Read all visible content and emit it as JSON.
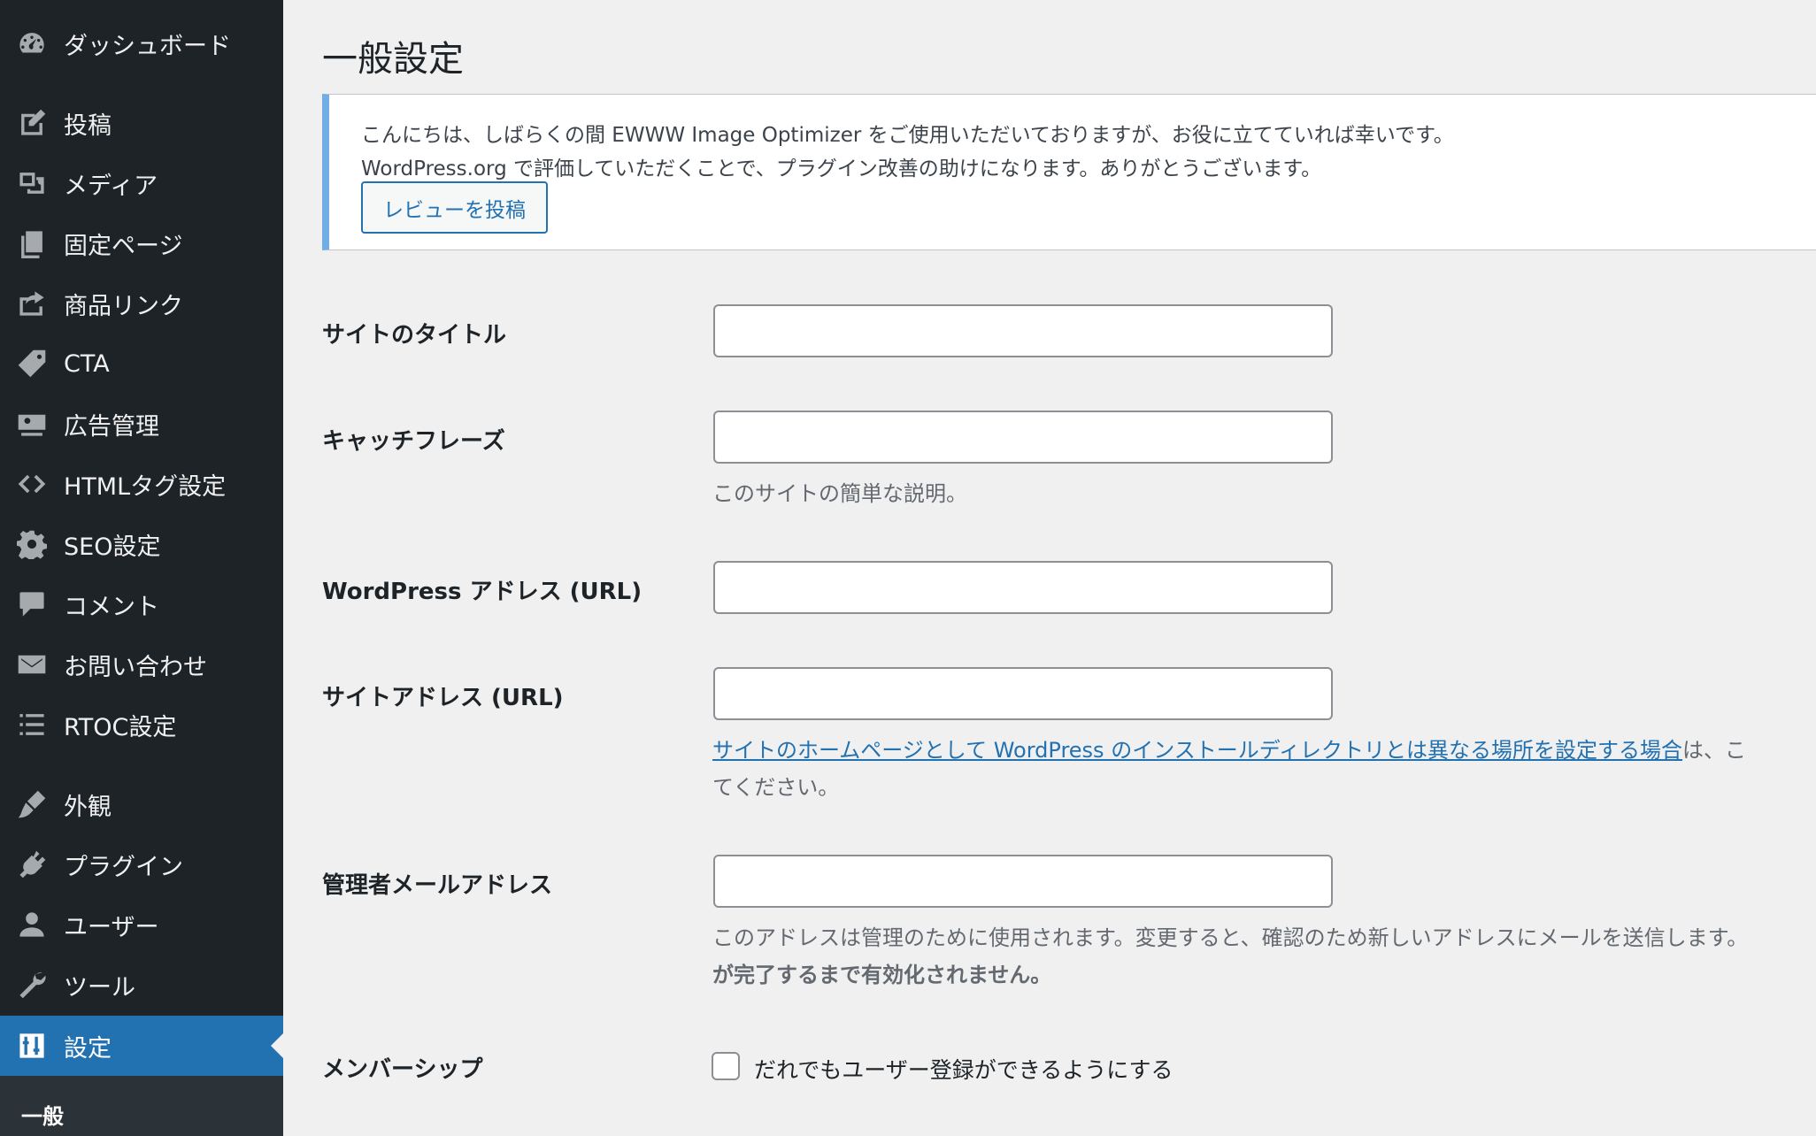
{
  "sidebar": {
    "items": [
      {
        "label": "ダッシュボード",
        "icon": "dashboard-icon"
      },
      {
        "label": "投稿",
        "icon": "post-edit-icon"
      },
      {
        "label": "メディア",
        "icon": "media-icon"
      },
      {
        "label": "固定ページ",
        "icon": "pages-icon"
      },
      {
        "label": "商品リンク",
        "icon": "external-link-icon"
      },
      {
        "label": "CTA",
        "icon": "tag-icon"
      },
      {
        "label": "広告管理",
        "icon": "ad-icon"
      },
      {
        "label": "HTMLタグ設定",
        "icon": "code-icon"
      },
      {
        "label": "SEO設定",
        "icon": "gear-icon"
      },
      {
        "label": "コメント",
        "icon": "comment-icon"
      },
      {
        "label": "お問い合わせ",
        "icon": "mail-icon"
      },
      {
        "label": "RTOC設定",
        "icon": "list-icon"
      },
      {
        "label": "外観",
        "icon": "brush-icon"
      },
      {
        "label": "プラグイン",
        "icon": "plugin-icon"
      },
      {
        "label": "ユーザー",
        "icon": "user-icon"
      },
      {
        "label": "ツール",
        "icon": "wrench-icon"
      },
      {
        "label": "設定",
        "icon": "settings-sliders-icon"
      }
    ],
    "active": "設定",
    "submenu_current": "一般"
  },
  "page": {
    "title": "一般設定"
  },
  "notice": {
    "line1": "こんにちは、しばらくの間 EWWW Image Optimizer をご使用いただいておりますが、お役に立てていれば幸いです。",
    "line2": "WordPress.org で評価していただくことで、プラグイン改善の助けになります。ありがとうございます。",
    "button_label": "レビューを投稿",
    "accent_color": "#72aee6"
  },
  "form": {
    "site_title": {
      "label": "サイトのタイトル",
      "value": ""
    },
    "tagline": {
      "label": "キャッチフレーズ",
      "value": "",
      "description": "このサイトの簡単な説明。"
    },
    "wp_address": {
      "label": "WordPress アドレス (URL)",
      "value": ""
    },
    "site_address": {
      "label": "サイトアドレス (URL)",
      "value": "",
      "description_link": "サイトのホームページとして WordPress のインストールディレクトリとは異なる場所を設定する場合",
      "description_after": "は、こ",
      "description_line2": "てください。"
    },
    "admin_email": {
      "label": "管理者メールアドレス",
      "value": "",
      "description_line1": "このアドレスは管理のために使用されます。変更すると、確認のため新しいアドレスにメールを送信します。",
      "description_line2": "が完了するまで有効化されません。"
    },
    "membership": {
      "label": "メンバーシップ",
      "checkbox_label": "だれでもユーザー登録ができるようにする",
      "checked": false
    }
  },
  "colors": {
    "sidebar_bg": "#1d2327",
    "active_bg": "#2271b1",
    "link": "#2271b1",
    "page_bg": "#f0f0f1"
  }
}
